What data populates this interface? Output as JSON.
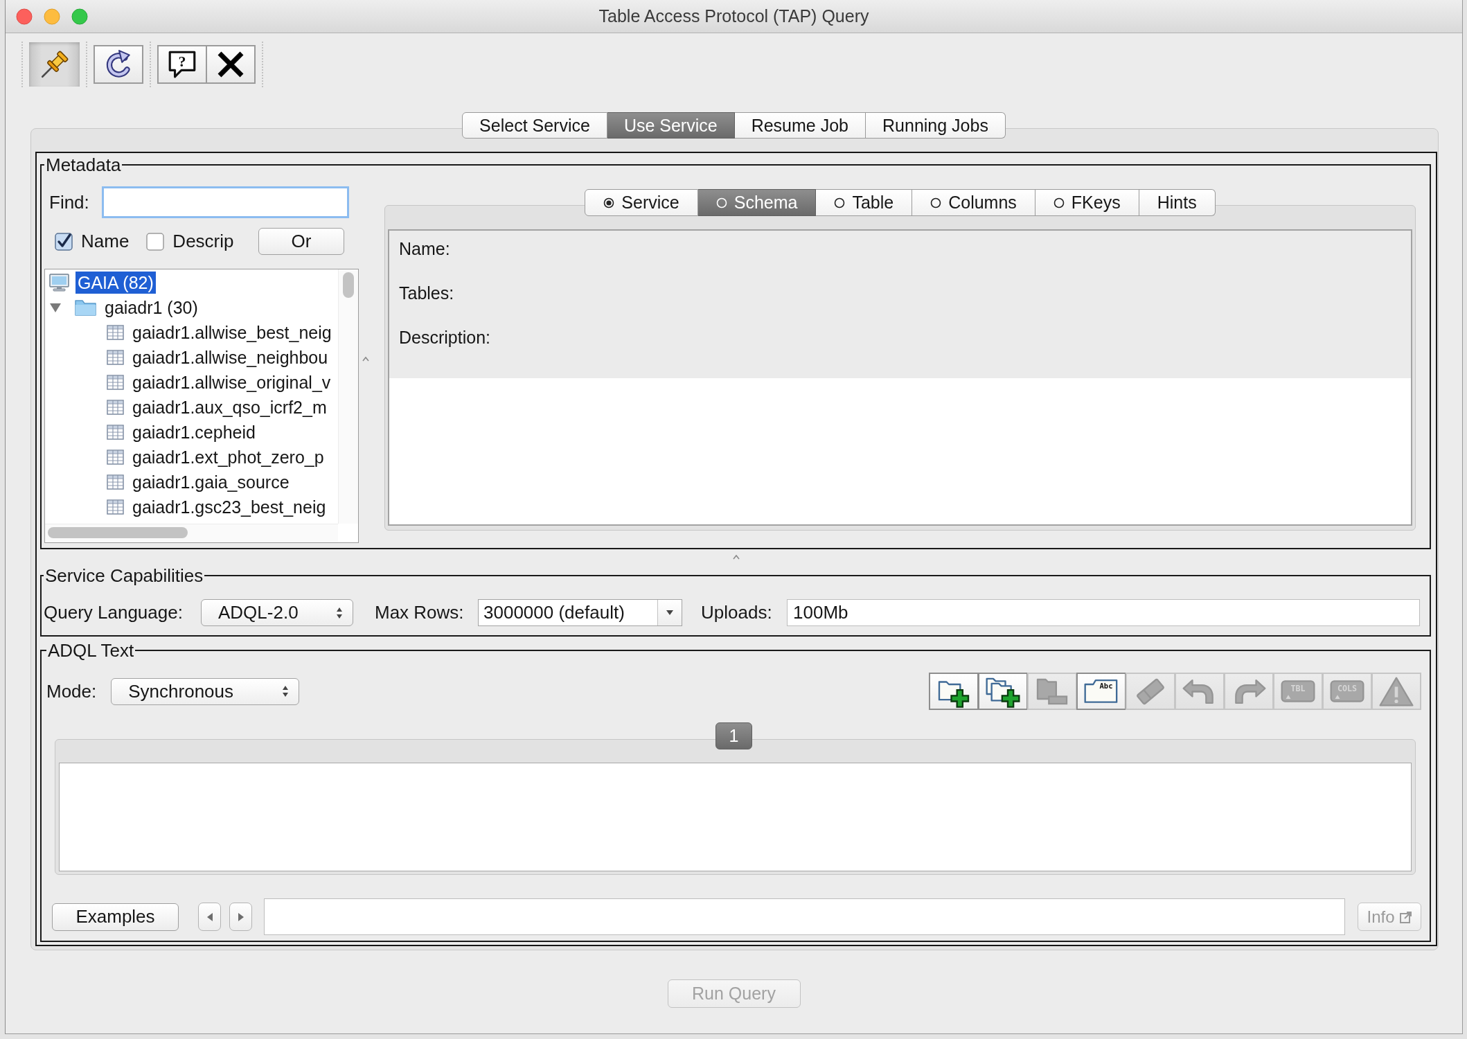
{
  "window": {
    "title": "Table Access Protocol (TAP) Query"
  },
  "toolbar_groups": [
    {
      "buttons": [
        {
          "kind": "pin",
          "on": true
        }
      ]
    },
    {
      "buttons": [
        {
          "kind": "refresh",
          "on": false
        }
      ]
    },
    {
      "buttons": [
        {
          "kind": "help",
          "on": false,
          "glyph": "?"
        },
        {
          "kind": "close",
          "on": false
        }
      ]
    }
  ],
  "service_tabs": [
    {
      "label": "Select Service",
      "selected": false
    },
    {
      "label": "Use Service",
      "selected": true
    },
    {
      "label": "Resume Job",
      "selected": false
    },
    {
      "label": "Running Jobs",
      "selected": false
    }
  ],
  "metadata": {
    "title": "Metadata",
    "find": {
      "label": "Find:",
      "focused": true
    },
    "match_options": [
      {
        "label": "Name",
        "checked": true
      },
      {
        "label": "Descrip",
        "checked": false
      }
    ],
    "or_button": "Or",
    "tree": [
      {
        "kind": "service",
        "label": "GAIA (82)",
        "selected": true,
        "children": [
          {
            "kind": "schema",
            "label": "gaiadr1 (30)",
            "selected": false,
            "expanded": true,
            "children": [
              {
                "kind": "table",
                "label": "gaiadr1.allwise_best_neig",
                "selected": false
              },
              {
                "kind": "table",
                "label": "gaiadr1.allwise_neighbou",
                "selected": false
              },
              {
                "kind": "table",
                "label": "gaiadr1.allwise_original_v",
                "selected": false
              },
              {
                "kind": "table",
                "label": "gaiadr1.aux_qso_icrf2_m",
                "selected": false
              },
              {
                "kind": "table",
                "label": "gaiadr1.cepheid",
                "selected": false
              },
              {
                "kind": "table",
                "label": "gaiadr1.ext_phot_zero_p",
                "selected": false
              },
              {
                "kind": "table",
                "label": "gaiadr1.gaia_source",
                "selected": false
              },
              {
                "kind": "table",
                "label": "gaiadr1.gsc23_best_neig",
                "selected": false
              }
            ]
          }
        ]
      }
    ],
    "detail_tabs": [
      {
        "kind": "radio",
        "label": "Service",
        "checked": true,
        "selected": false
      },
      {
        "kind": "radio",
        "label": "Schema",
        "checked": false,
        "selected": true
      },
      {
        "kind": "radio",
        "label": "Table",
        "checked": false,
        "selected": false
      },
      {
        "kind": "radio",
        "label": "Columns",
        "checked": false,
        "selected": false
      },
      {
        "kind": "radio",
        "label": "FKeys",
        "checked": false,
        "selected": false
      },
      {
        "kind": "plain",
        "label": "Hints",
        "selected": false
      }
    ],
    "detail_fields": [
      "Name:",
      "Tables:",
      "Description:"
    ]
  },
  "service_capabilities": {
    "title": "Service Capabilities",
    "query_language": {
      "label": "Query Language:",
      "value": "ADQL-2.0"
    },
    "max_rows": {
      "label": "Max Rows:",
      "value": "3000000 (default)"
    },
    "uploads": {
      "label": "Uploads:",
      "value": "100Mb"
    }
  },
  "adql_text": {
    "title": "ADQL Text",
    "mode": {
      "label": "Mode:",
      "value": "Synchronous"
    },
    "tools": [
      {
        "kind": "add",
        "disabled": false
      },
      {
        "kind": "copy",
        "disabled": false
      },
      {
        "kind": "remove",
        "disabled": true
      },
      {
        "kind": "rename",
        "disabled": false,
        "caption": "Abc"
      },
      {
        "kind": "clear",
        "disabled": true
      },
      {
        "kind": "undo",
        "disabled": true
      },
      {
        "kind": "redo",
        "disabled": true
      },
      {
        "kind": "table",
        "disabled": true,
        "caption": "TBL"
      },
      {
        "kind": "columns",
        "disabled": true,
        "caption": "COLS"
      },
      {
        "kind": "warning",
        "disabled": true
      }
    ],
    "query_tabs": [
      {
        "label": "1",
        "selected": true
      }
    ],
    "examples_button": "Examples",
    "info_button": {
      "label": "Info",
      "disabled": true
    }
  },
  "run_button": {
    "label": "Run Query",
    "disabled": true
  }
}
